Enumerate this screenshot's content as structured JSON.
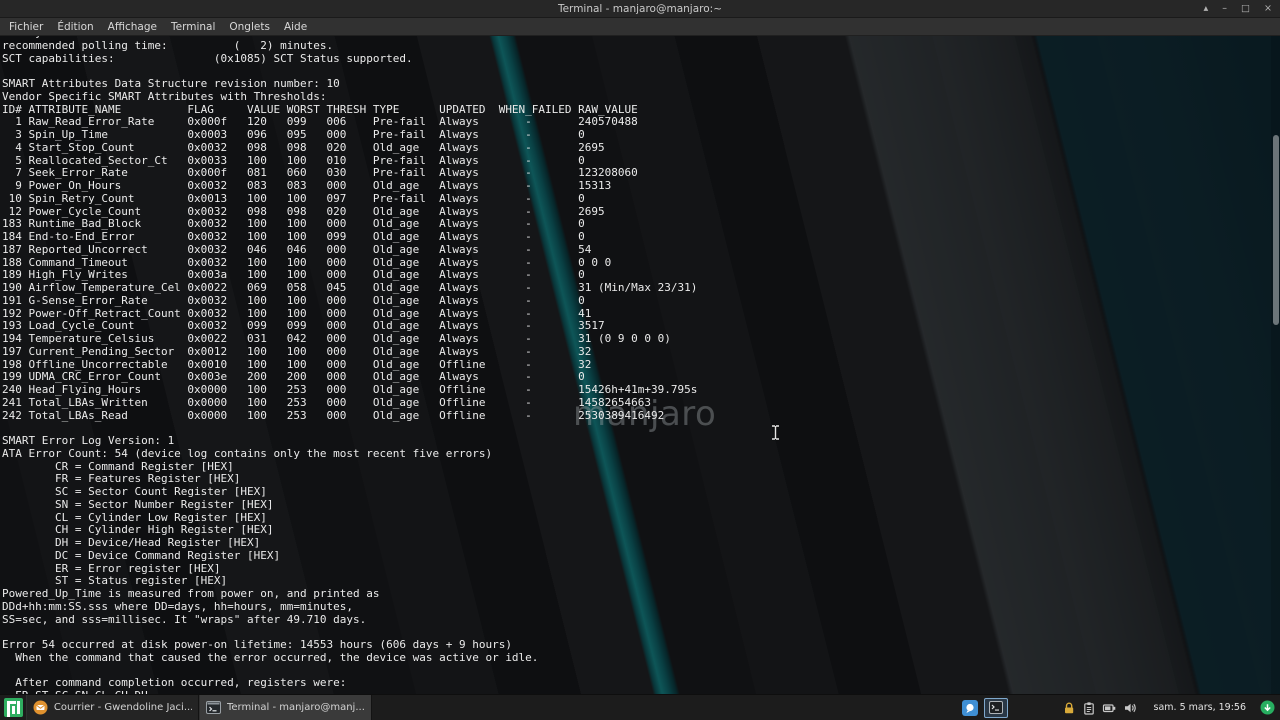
{
  "window": {
    "title": "Terminal - manjaro@manjaro:~",
    "controls": {
      "shade": "▴",
      "minimize": "–",
      "maximize": "□",
      "close": "×"
    }
  },
  "menubar": {
    "items": [
      "Fichier",
      "Édition",
      "Affichage",
      "Terminal",
      "Onglets",
      "Aide"
    ]
  },
  "wallpaper": {
    "watermark": "manjaro"
  },
  "terminal": {
    "lines": [
      "Conveyance self-test routine",
      "recommended polling time:          (   2) minutes.",
      "SCT capabilities:               (0x1085) SCT Status supported.",
      "",
      "SMART Attributes Data Structure revision number: 10",
      "Vendor Specific SMART Attributes with Thresholds:",
      "ID# ATTRIBUTE_NAME          FLAG     VALUE WORST THRESH TYPE      UPDATED  WHEN_FAILED RAW_VALUE",
      "  1 Raw_Read_Error_Rate     0x000f   120   099   006    Pre-fail  Always       -       240570488",
      "  3 Spin_Up_Time            0x0003   096   095   000    Pre-fail  Always       -       0",
      "  4 Start_Stop_Count        0x0032   098   098   020    Old_age   Always       -       2695",
      "  5 Reallocated_Sector_Ct   0x0033   100   100   010    Pre-fail  Always       -       0",
      "  7 Seek_Error_Rate         0x000f   081   060   030    Pre-fail  Always       -       123208060",
      "  9 Power_On_Hours          0x0032   083   083   000    Old_age   Always       -       15313",
      " 10 Spin_Retry_Count        0x0013   100   100   097    Pre-fail  Always       -       0",
      " 12 Power_Cycle_Count       0x0032   098   098   020    Old_age   Always       -       2695",
      "183 Runtime_Bad_Block       0x0032   100   100   000    Old_age   Always       -       0",
      "184 End-to-End_Error        0x0032   100   100   099    Old_age   Always       -       0",
      "187 Reported_Uncorrect      0x0032   046   046   000    Old_age   Always       -       54",
      "188 Command_Timeout         0x0032   100   100   000    Old_age   Always       -       0 0 0",
      "189 High_Fly_Writes         0x003a   100   100   000    Old_age   Always       -       0",
      "190 Airflow_Temperature_Cel 0x0022   069   058   045    Old_age   Always       -       31 (Min/Max 23/31)",
      "191 G-Sense_Error_Rate      0x0032   100   100   000    Old_age   Always       -       0",
      "192 Power-Off_Retract_Count 0x0032   100   100   000    Old_age   Always       -       41",
      "193 Load_Cycle_Count        0x0032   099   099   000    Old_age   Always       -       3517",
      "194 Temperature_Celsius     0x0022   031   042   000    Old_age   Always       -       31 (0 9 0 0 0)",
      "197 Current_Pending_Sector  0x0012   100   100   000    Old_age   Always       -       32",
      "198 Offline_Uncorrectable   0x0010   100   100   000    Old_age   Offline      -       32",
      "199 UDMA_CRC_Error_Count    0x003e   200   200   000    Old_age   Always       -       0",
      "240 Head_Flying_Hours       0x0000   100   253   000    Old_age   Offline      -       15426h+41m+39.795s",
      "241 Total_LBAs_Written      0x0000   100   253   000    Old_age   Offline      -       14582654663",
      "242 Total_LBAs_Read         0x0000   100   253   000    Old_age   Offline      -       2530389416492",
      "",
      "SMART Error Log Version: 1",
      "ATA Error Count: 54 (device log contains only the most recent five errors)",
      "        CR = Command Register [HEX]",
      "        FR = Features Register [HEX]",
      "        SC = Sector Count Register [HEX]",
      "        SN = Sector Number Register [HEX]",
      "        CL = Cylinder Low Register [HEX]",
      "        CH = Cylinder High Register [HEX]",
      "        DH = Device/Head Register [HEX]",
      "        DC = Device Command Register [HEX]",
      "        ER = Error register [HEX]",
      "        ST = Status register [HEX]",
      "Powered_Up_Time is measured from power on, and printed as",
      "DDd+hh:mm:SS.sss where DD=days, hh=hours, mm=minutes,",
      "SS=sec, and sss=millisec. It \"wraps\" after 49.710 days.",
      "",
      "Error 54 occurred at disk power-on lifetime: 14553 hours (606 days + 9 hours)",
      "  When the command that caused the error occurred, the device was active or idle.",
      "",
      "  After command completion occurred, registers were:",
      "  ER ST SC SN CL CH DH"
    ]
  },
  "taskbar": {
    "tasks": [
      {
        "label": "Courrier - Gwendoline Jaci...",
        "icon": "mail-icon"
      },
      {
        "label": "Terminal - manjaro@manj...",
        "icon": "terminal-icon",
        "active": true
      }
    ],
    "tray_icons": [
      "messenger-icon",
      "terminal-indicator-icon",
      "lock-icon",
      "clipboard-icon",
      "battery-icon",
      "volume-icon",
      "update-available-icon"
    ],
    "clock": "sam. 5 mars, 19:56"
  },
  "colors": {
    "manjaro_green": "#2fae60",
    "teal_accent": "#17b3b3",
    "terminal_text": "#ebebeb",
    "taskbar_bg": "#1c1c1c",
    "update_green": "#27ae60"
  }
}
